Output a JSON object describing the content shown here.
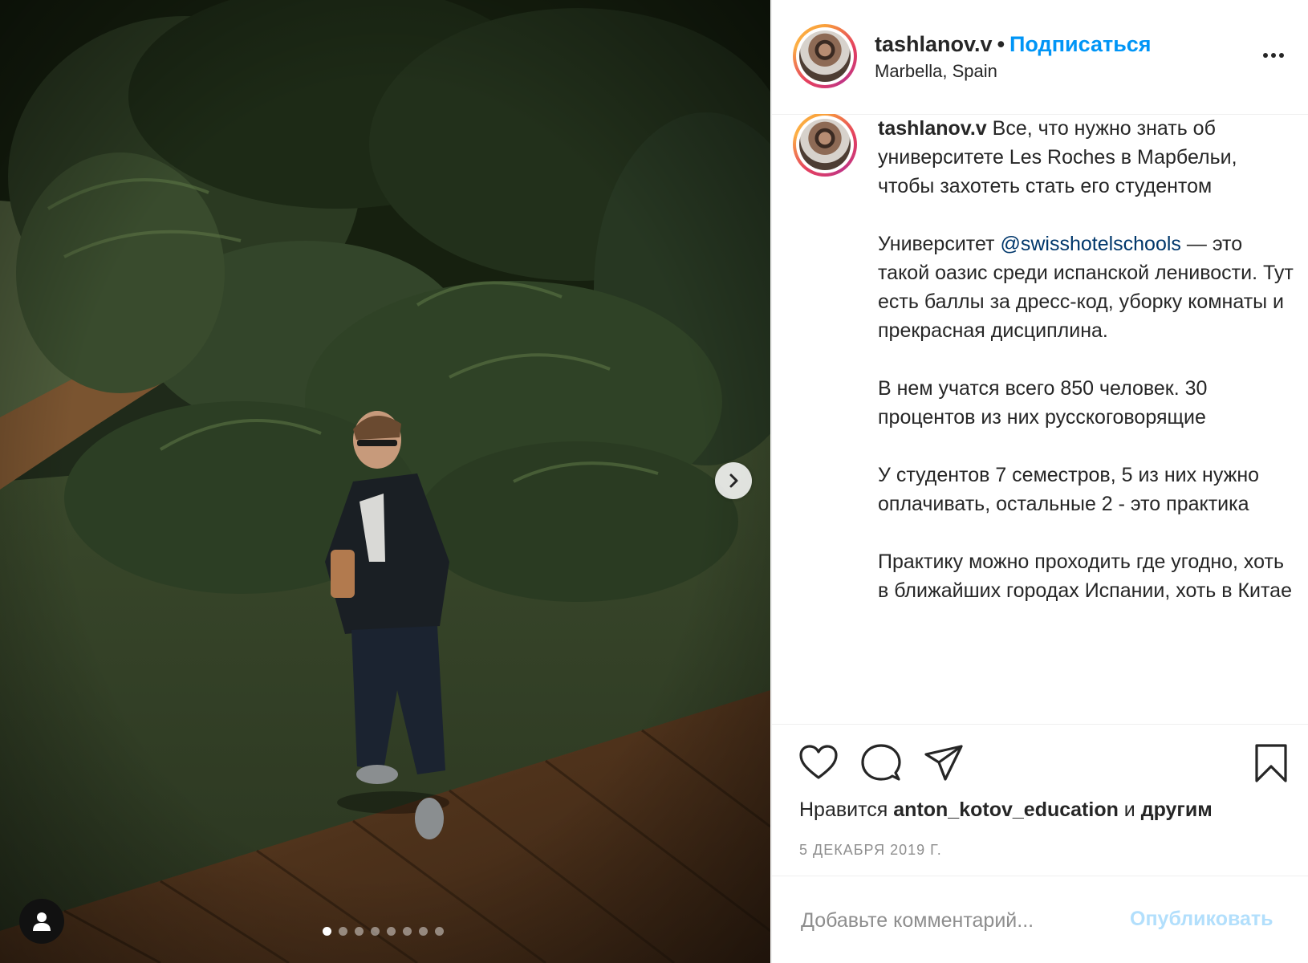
{
  "post": {
    "username": "tashlanov.v",
    "separator": "•",
    "follow_label": "Подписаться",
    "location": "Marbella, Spain",
    "more_icon": "more-options-icon",
    "caption": {
      "username": "tashlanov.v",
      "intro": "Все, что нужно знать об университете Les Roches в Марбельи, чтобы захотеть стать его студентом",
      "p2_before": "Университет ",
      "p2_mention": "@swisshotelschools",
      "p2_after": " — это такой оазис среди испанской ленивости. Тут есть баллы за дресс-код, уборку комнаты и прекрасная дисциплина.",
      "p3": "В нем учатся всего 850 человек. 30 процентов из них русскоговорящие",
      "p4": "У студентов 7 семестров, 5 из них нужно оплачивать, остальные 2 - это практика",
      "p5": "Практику можно проходить где угодно, хоть в ближайших городах Испании, хоть в Китае"
    },
    "likes": {
      "prefix": "Нравится ",
      "user": "anton_kotov_education",
      "middle": " и ",
      "suffix": "другим"
    },
    "date": "5 ДЕКАБРЯ 2019 Г.",
    "comment": {
      "placeholder": "Добавьте комментарий...",
      "publish_label": "Опубликовать"
    }
  },
  "carousel": {
    "slide_count": 8,
    "active_index": 0
  },
  "icons": {
    "like": "heart-icon",
    "comment": "comment-icon",
    "share": "share-paper-plane-icon",
    "save": "bookmark-icon",
    "next": "chevron-right-icon",
    "tagged": "user-tag-icon"
  },
  "colors": {
    "link_blue": "#0095f6",
    "mention_blue": "#00376b",
    "publish_disabled": "#b2dffc",
    "muted_gray": "#8e8e8e"
  }
}
